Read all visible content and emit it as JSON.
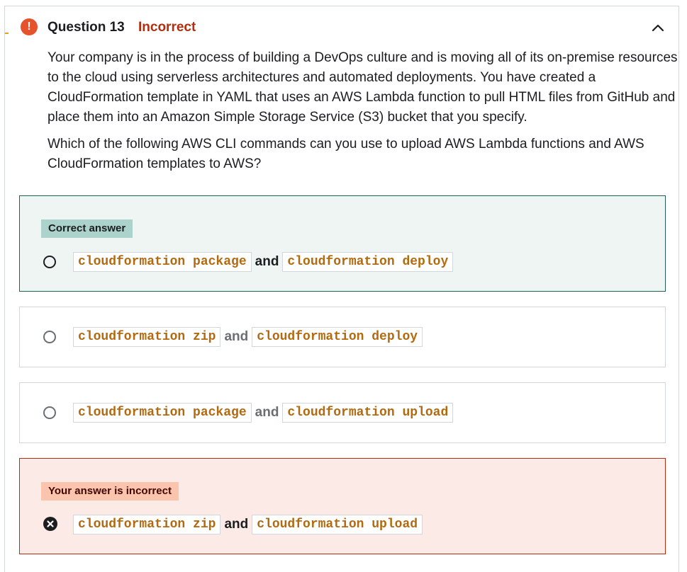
{
  "header": {
    "title": "Question 13",
    "status": "Incorrect",
    "alert_icon": "!"
  },
  "question": {
    "paragraph1": "Your company is in the process of building a DevOps culture and is moving all of its on-premise resources to the cloud using serverless architectures and automated deployments. You have created a CloudFormation template in YAML that uses an AWS Lambda function to pull HTML files from GitHub and place them into an Amazon Simple Storage Service (S3) bucket that you specify.",
    "paragraph2": "Which of the following AWS CLI commands can you use to upload AWS Lambda functions and AWS CloudFormation templates to AWS?"
  },
  "options": [
    {
      "badge": "Correct answer",
      "cmd1": "cloudformation package",
      "joiner": "and",
      "cmd2": "cloudformation deploy",
      "state": "correct"
    },
    {
      "cmd1": "cloudformation zip",
      "joiner": "and",
      "cmd2": "cloudformation deploy",
      "state": "neutral"
    },
    {
      "cmd1": "cloudformation package",
      "joiner": "and",
      "cmd2": "cloudformation upload",
      "state": "neutral"
    },
    {
      "badge": "Your answer is incorrect",
      "cmd1": "cloudformation zip",
      "joiner": "and",
      "cmd2": "cloudformation upload",
      "state": "selected-incorrect"
    }
  ],
  "colors": {
    "incorrect": "#b32d0f",
    "correct_border": "#1e6055",
    "correct_bg": "#eef5f3",
    "wrong_bg": "#fceae6",
    "code": "#b4690e"
  },
  "icons": {
    "alert": "alert-icon",
    "collapse": "chevron-up-icon",
    "selected_wrong": "x-circle-icon"
  }
}
